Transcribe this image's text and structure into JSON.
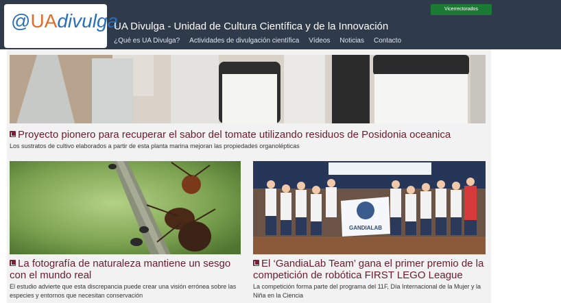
{
  "header": {
    "logo": {
      "prefix": "@",
      "ua": "UA",
      "divulga": "divulga"
    },
    "title": "UA Divulga - Unidad de Cultura Científica y de la Innovación",
    "vicerrectorados_label": "Vicerrectorados",
    "nav": [
      {
        "label": "¿Qué es UA Divulga?"
      },
      {
        "label": "Actividades de divulgación científica"
      },
      {
        "label": "Vídeos"
      },
      {
        "label": "Noticias"
      },
      {
        "label": "Contacto"
      }
    ]
  },
  "colors": {
    "header_bg": "#2f3b4a",
    "headline": "#6a1b2d",
    "button_green": "#1b7a33",
    "logo_blue": "#2a6fb8",
    "logo_orange": "#e06b2b"
  },
  "articles": [
    {
      "headline": "Proyecto pionero para recuperar el sabor del tomate utilizando residuos de Posidonia oceanica",
      "summary": "Los sustratos de cultivo elaborados a partir de esta planta marina mejoran las propiedades organolépticas"
    },
    {
      "headline": "La fotografía de naturaleza mantiene un sesgo con el mundo real",
      "summary": "El estudio advierte que esta discrepancia puede crear una visión errónea sobre las especies y entornos que necesitan conservación"
    },
    {
      "headline": "El ‘GandiaLab Team’ gana el primer premio de la competición de robótica FIRST LEGO League",
      "summary": "La competición forma parte del programa del 11F, Día Internacional de la Mujer y la Niña en la Ciencia",
      "photo_banner": "GANDIALAB"
    }
  ]
}
